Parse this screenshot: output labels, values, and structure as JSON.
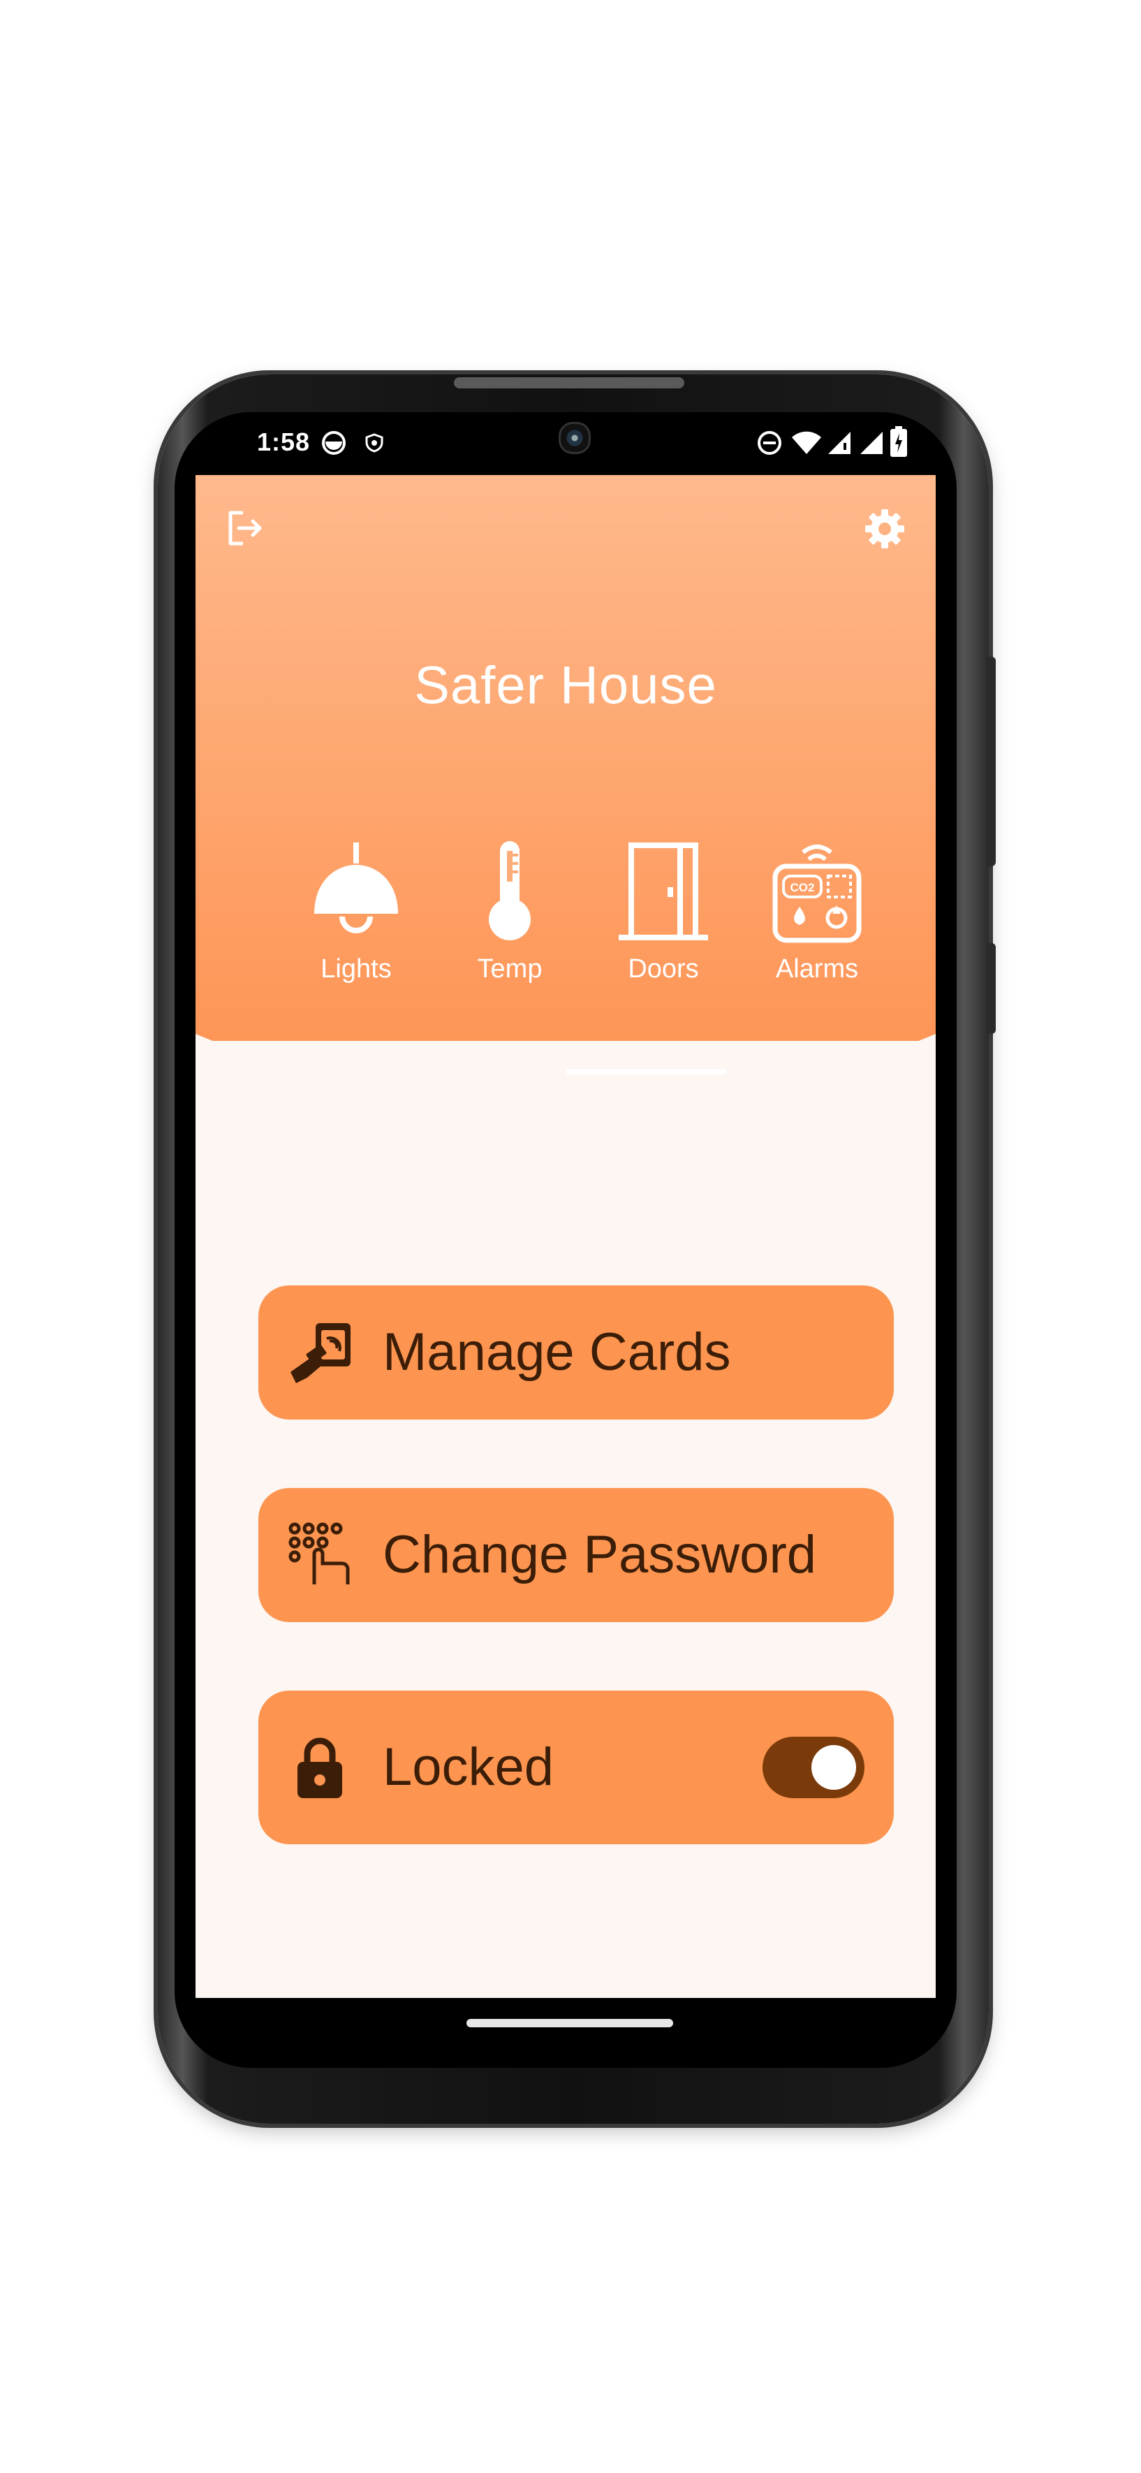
{
  "status_bar": {
    "time": "1:58",
    "icons": [
      "circle-notification-icon",
      "shield-notification-icon",
      "do-not-disturb-icon",
      "wifi-icon",
      "signal-icon",
      "signal-icon",
      "battery-icon"
    ]
  },
  "header": {
    "title": "Safer House",
    "logout_icon": "logout-icon",
    "settings_icon": "gear-icon",
    "gradient_top": "#ffb98c",
    "gradient_bottom": "#fd9150"
  },
  "tabs": [
    {
      "label": "Lights",
      "icon": "ceiling-lamp-icon",
      "selected": false
    },
    {
      "label": "Temp",
      "icon": "thermometer-icon",
      "selected": false
    },
    {
      "label": "Doors",
      "icon": "door-icon",
      "selected": true
    },
    {
      "label": "Alarms",
      "icon": "alarm-panel-icon",
      "selected": false
    }
  ],
  "alarm_icon_text": "CO2",
  "actions": {
    "manage_cards": {
      "label": "Manage Cards",
      "icon": "card-reader-icon"
    },
    "change_password": {
      "label": "Change Password",
      "icon": "keypad-icon"
    },
    "lock": {
      "label": "Locked",
      "icon": "lock-icon",
      "toggle_on": true
    }
  },
  "colors": {
    "accent": "#fd9550",
    "text_dark": "#3b1d08",
    "toggle_track": "#7a3a09",
    "background": "#fdf6f3"
  }
}
